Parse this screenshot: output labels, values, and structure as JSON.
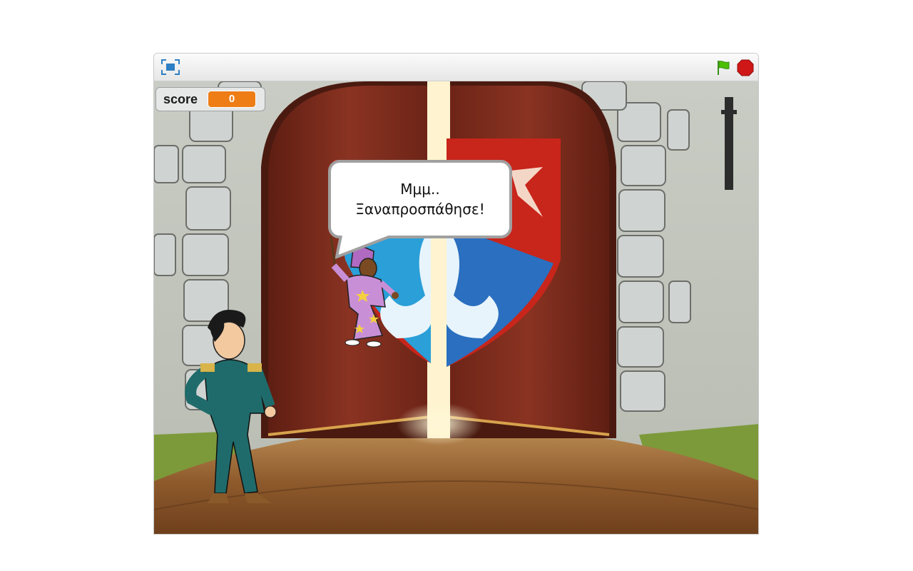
{
  "window": {
    "controls": {
      "fullscreen_icon": "fullscreen-icon",
      "green_flag_icon": "green-flag-icon",
      "stop_icon": "stop-sign-icon"
    }
  },
  "stage": {
    "monitor": {
      "label": "score",
      "value": "0"
    },
    "speech_bubble": {
      "line1": "Μμμ..",
      "line2": "Ξαναπροσπάθησε!"
    },
    "sprites": [
      "wizard-sprite",
      "prince-sprite"
    ]
  },
  "colors": {
    "monitor_value_bg": "#ee7d16",
    "green_flag": "#4cbf00",
    "stop": "#d01717",
    "door_wood": "#7a2a1a",
    "shield_red": "#c8251b",
    "shield_blue": "#2a9fd8"
  }
}
